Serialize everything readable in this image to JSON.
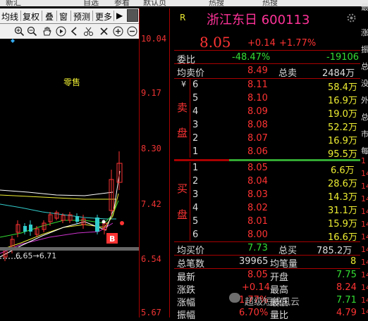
{
  "top_menu": [
    "新汇",
    "自选",
    "参看",
    "默认页",
    "热搜",
    "热搜"
  ],
  "toolbar": {
    "items": [
      "均线",
      "复权",
      "叠",
      "窗",
      "预测",
      "更多"
    ],
    "arrow": "▶"
  },
  "chart": {
    "price_ticks": [
      "10.04",
      "9.17",
      "8.30",
      "7.42",
      "6.54",
      "5.67"
    ],
    "label_retail": "零售",
    "range_label": "6.65→6.71",
    "b_marker": "B",
    "colors": {
      "up": "#ff3333",
      "down": "#33cccc",
      "ma5": "#ffffff",
      "ma10": "#eeee33",
      "ma20": "#cc33cc",
      "ma60": "#33dd33"
    }
  },
  "quote": {
    "r_badge": "R",
    "title": "浙江东日 600113",
    "price": "8.05",
    "change": "+0.14",
    "change_pct": "+1.77%",
    "weibi_label": "委比",
    "weibi_value": "-48.47%",
    "weicha_value": "-19106",
    "avg_sell_label": "均卖价",
    "avg_sell_value": "8.49",
    "total_sell_label": "总卖",
    "total_sell_value": "2484万",
    "sell_side_chars": [
      "¥",
      "卖",
      "盘"
    ],
    "sell_orders": [
      {
        "level": "6",
        "price": "8.11",
        "volume": "58.4万"
      },
      {
        "level": "5",
        "price": "8.10",
        "volume": "16.9万"
      },
      {
        "level": "4",
        "price": "8.09",
        "volume": "19.0万"
      },
      {
        "level": "3",
        "price": "8.08",
        "volume": "52.2万"
      },
      {
        "level": "2",
        "price": "8.07",
        "volume": "16.9万"
      },
      {
        "level": "1",
        "price": "8.06",
        "volume": "95.5万"
      }
    ],
    "buy_side_chars": [
      "买",
      "盘"
    ],
    "buy_orders": [
      {
        "level": "1",
        "price": "8.05",
        "volume": "6.6万"
      },
      {
        "level": "2",
        "price": "8.04",
        "volume": "28.6万"
      },
      {
        "level": "3",
        "price": "8.03",
        "volume": "14.3万"
      },
      {
        "level": "4",
        "price": "8.02",
        "volume": "31.1万"
      },
      {
        "level": "5",
        "price": "8.01",
        "volume": "15.9万"
      },
      {
        "level": "6",
        "price": "8.00",
        "volume": "16.6万"
      }
    ],
    "avg_buy_label": "均买价",
    "avg_buy_value": "7.73",
    "total_buy_label": "总买",
    "total_buy_value": "785.2万",
    "total_trades_label": "总笔数",
    "total_trades_value": "39965",
    "avg_per_trade_label": "均笔量",
    "avg_per_trade_value": "8",
    "stats": [
      {
        "l1": "最新",
        "v1": "8.05",
        "l2": "开盘",
        "v2": "7.75"
      },
      {
        "l1": "涨跌",
        "v1": "+0.14",
        "l2": "最高",
        "v2": "8.24"
      },
      {
        "l1": "涨幅",
        "v1": "1.77%",
        "l2": "最低",
        "v2": "7.71"
      },
      {
        "l1": "振幅",
        "v1": "6.70%",
        "l2": "量比",
        "v2": "4.79"
      }
    ],
    "watermark": "超级短线风云"
  },
  "right_strip": [
    "最",
    "涨",
    "振",
    "总",
    "没",
    "外",
    "总",
    "市",
    "每",
    "1",
    "14",
    "14",
    "14",
    "14",
    "14",
    "14",
    "14",
    "14",
    "14",
    "14",
    "14",
    "14",
    "14"
  ]
}
